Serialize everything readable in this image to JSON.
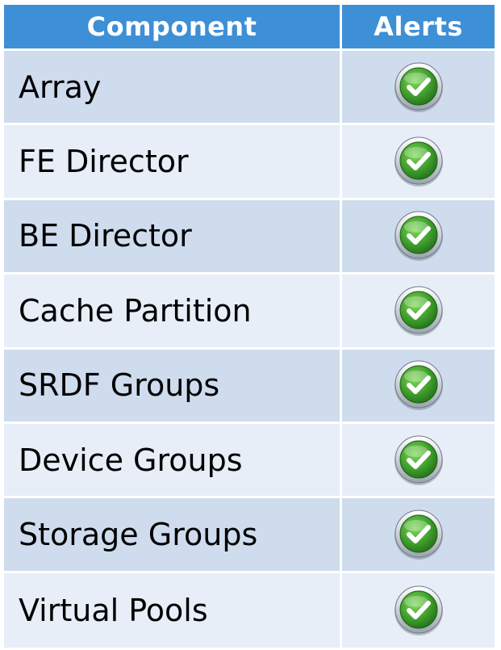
{
  "table": {
    "headers": {
      "component": "Component",
      "alerts": "Alerts"
    },
    "rows": [
      {
        "component": "Array",
        "alert_icon": "check-ok-icon"
      },
      {
        "component": "FE Director",
        "alert_icon": "check-ok-icon"
      },
      {
        "component": "BE Director",
        "alert_icon": "check-ok-icon"
      },
      {
        "component": "Cache Partition",
        "alert_icon": "check-ok-icon"
      },
      {
        "component": "SRDF Groups",
        "alert_icon": "check-ok-icon"
      },
      {
        "component": "Device Groups",
        "alert_icon": "check-ok-icon"
      },
      {
        "component": "Storage Groups",
        "alert_icon": "check-ok-icon"
      },
      {
        "component": "Virtual Pools",
        "alert_icon": "check-ok-icon"
      }
    ]
  },
  "colors": {
    "header_bg": "#3d8fd6",
    "row_dark": "#cfdcee",
    "row_light": "#e7eef8",
    "check_green": "#3f9e2c"
  }
}
